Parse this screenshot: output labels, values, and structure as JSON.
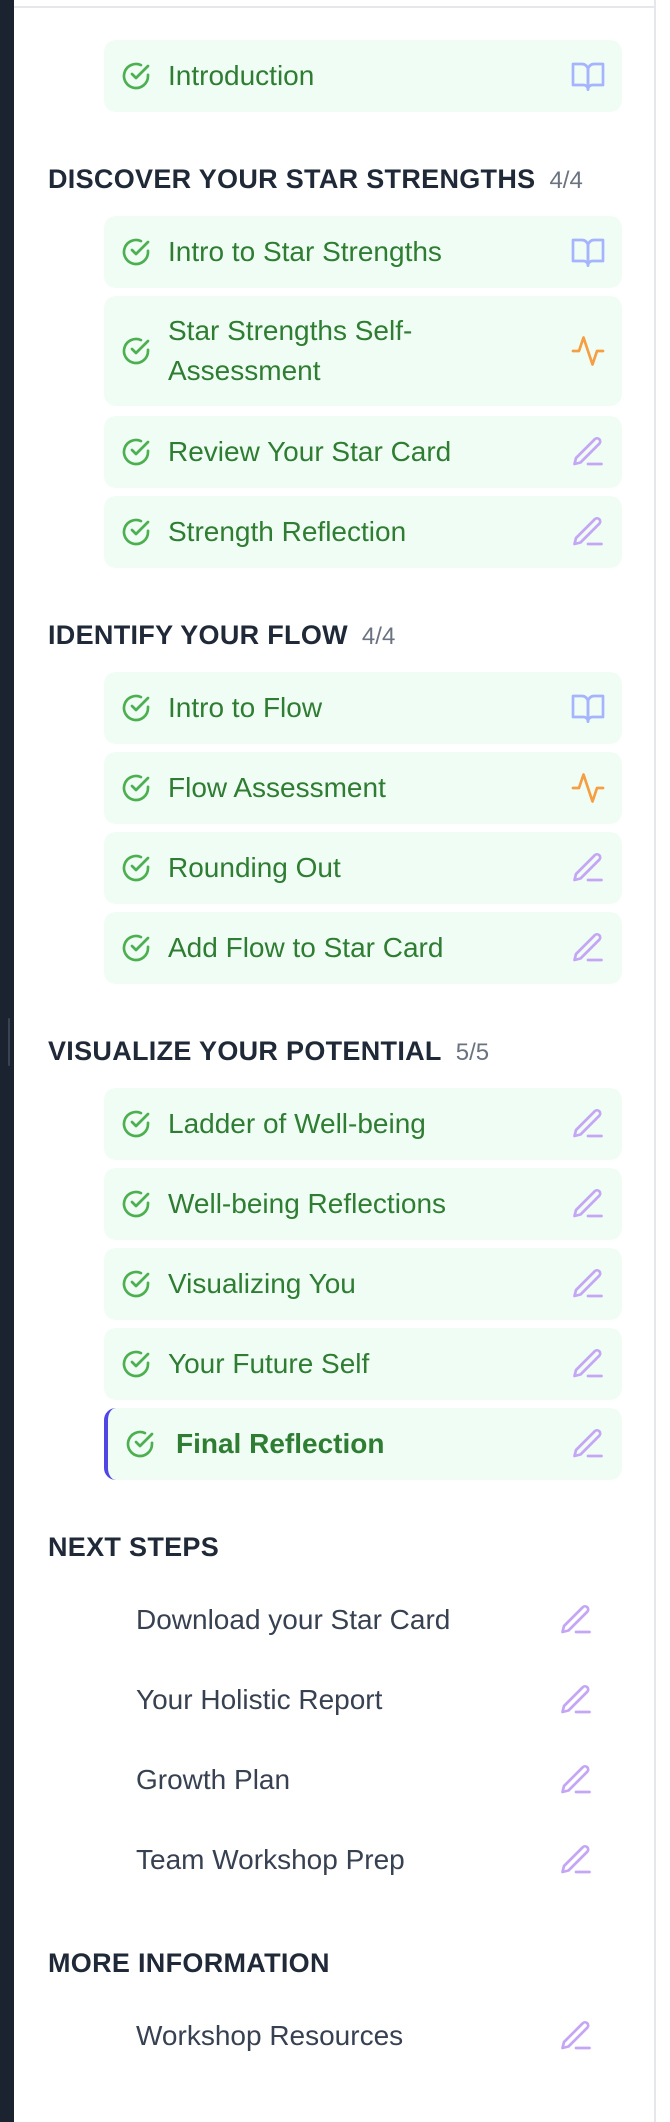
{
  "intro": {
    "label": "Introduction",
    "icon": "book-icon"
  },
  "sections": {
    "strengths": {
      "title": "DISCOVER YOUR STAR STRENGTHS",
      "count": "4/4",
      "items": [
        {
          "label": "Intro to Star Strengths",
          "icon": "book-icon"
        },
        {
          "label": "Star Strengths Self-Assessment",
          "icon": "activity-icon"
        },
        {
          "label": "Review Your Star Card",
          "icon": "pencil-icon"
        },
        {
          "label": "Strength Reflection",
          "icon": "pencil-icon"
        }
      ]
    },
    "flow": {
      "title": "IDENTIFY YOUR FLOW",
      "count": "4/4",
      "items": [
        {
          "label": "Intro to Flow",
          "icon": "book-icon"
        },
        {
          "label": "Flow Assessment",
          "icon": "activity-icon"
        },
        {
          "label": "Rounding Out",
          "icon": "pencil-icon"
        },
        {
          "label": "Add Flow to Star Card",
          "icon": "pencil-icon"
        }
      ]
    },
    "potential": {
      "title": "VISUALIZE YOUR POTENTIAL",
      "count": "5/5",
      "items": [
        {
          "label": "Ladder of Well-being",
          "icon": "pencil-icon"
        },
        {
          "label": "Well-being Reflections",
          "icon": "pencil-icon"
        },
        {
          "label": "Visualizing You",
          "icon": "pencil-icon"
        },
        {
          "label": "Your Future Self",
          "icon": "pencil-icon"
        },
        {
          "label": "Final Reflection",
          "icon": "pencil-icon",
          "active": true
        }
      ]
    },
    "next_steps": {
      "title": "NEXT STEPS",
      "items": [
        {
          "label": "Download your Star Card",
          "icon": "pencil-icon"
        },
        {
          "label": "Your Holistic Report",
          "icon": "pencil-icon"
        },
        {
          "label": "Growth Plan",
          "icon": "pencil-icon"
        },
        {
          "label": "Team Workshop Prep",
          "icon": "pencil-icon"
        }
      ]
    },
    "more_info": {
      "title": "MORE INFORMATION",
      "items": [
        {
          "label": "Workshop Resources",
          "icon": "pencil-icon"
        }
      ]
    }
  },
  "colors": {
    "completed_bg": "#f0fdf4",
    "completed_text": "#2e7d32",
    "check": "#4caf50",
    "book_icon": "#a5b4fc",
    "activity_icon": "#f59e42",
    "pencil_icon": "#c4a6f5",
    "active_border": "#4f46e5"
  }
}
